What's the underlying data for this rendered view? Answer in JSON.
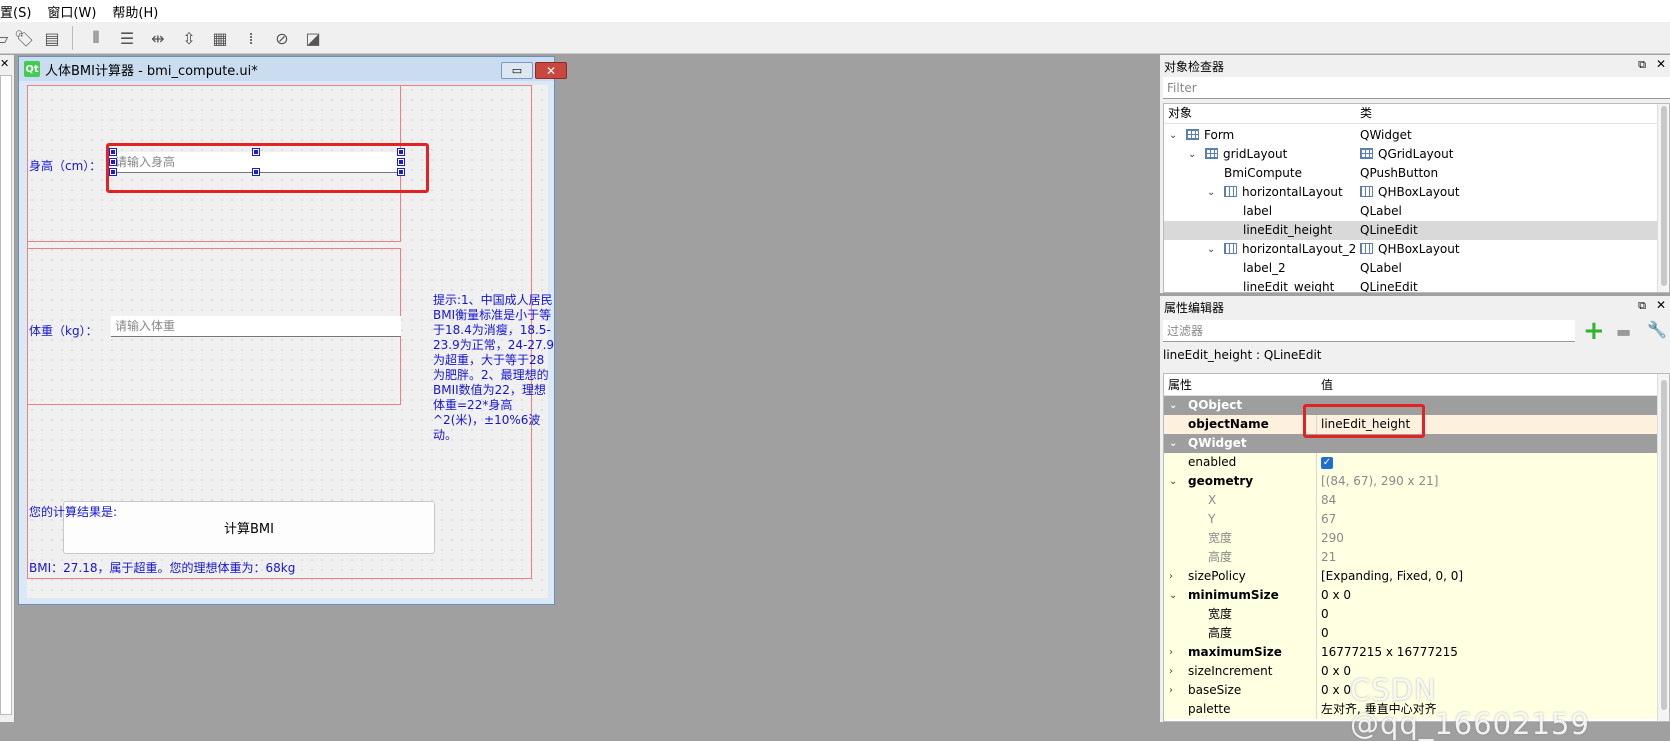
{
  "menubar": {
    "items": [
      "置(S)",
      "窗口(W)",
      "帮助(H)"
    ]
  },
  "form_window": {
    "title": "人体BMI计算器 - bmi_compute.ui*",
    "height_label": "身高（cm）：",
    "height_placeholder": "请输入身高",
    "weight_label": "体重（kg）：",
    "weight_placeholder": "请输入体重",
    "hint": "提示:1、中国成人居民BMI衡量标准是小于等于18.4为消瘦，18.5-23.9为正常，24-27.9为超重，大于等于28为肥胖。2、最理想的BMII数值为22，理想体重=22*身高^2(米)，±10%6波动。",
    "compute_button": "计算BMI",
    "result_label": "您的计算结果是:",
    "bmi_result": "BMI：27.18，属于超重。您的理想体重为：68kg"
  },
  "object_inspector": {
    "title": "对象检查器",
    "filter_placeholder": "Filter",
    "col_object": "对象",
    "col_class": "类",
    "rows": [
      {
        "name": "Form",
        "cls": "QWidget"
      },
      {
        "name": "gridLayout",
        "cls": "QGridLayout"
      },
      {
        "name": "BmiCompute",
        "cls": "QPushButton"
      },
      {
        "name": "horizontalLayout",
        "cls": "QHBoxLayout"
      },
      {
        "name": "label",
        "cls": "QLabel"
      },
      {
        "name": "lineEdit_height",
        "cls": "QLineEdit"
      },
      {
        "name": "horizontalLayout_2",
        "cls": "QHBoxLayout"
      },
      {
        "name": "label_2",
        "cls": "QLabel"
      },
      {
        "name": "lineEdit_weight",
        "cls": "QLineEdit"
      }
    ]
  },
  "property_editor": {
    "title": "属性编辑器",
    "filter_placeholder": "过滤器",
    "current": "lineEdit_height : QLineEdit",
    "col_property": "属性",
    "col_value": "值",
    "rows": [
      {
        "name": "QObject",
        "value": ""
      },
      {
        "name": "objectName",
        "value": "lineEdit_height"
      },
      {
        "name": "QWidget",
        "value": ""
      },
      {
        "name": "enabled",
        "value": ""
      },
      {
        "name": "geometry",
        "value": "[(84, 67), 290 x 21]"
      },
      {
        "name": "X",
        "value": "84"
      },
      {
        "name": "Y",
        "value": "67"
      },
      {
        "name": "宽度",
        "value": "290"
      },
      {
        "name": "高度",
        "value": "21"
      },
      {
        "name": "sizePolicy",
        "value": "[Expanding, Fixed, 0, 0]"
      },
      {
        "name": "minimumSize",
        "value": "0 x 0"
      },
      {
        "name": "宽度",
        "value": "0"
      },
      {
        "name": "高度",
        "value": "0"
      },
      {
        "name": "maximumSize",
        "value": "16777215 x 16777215"
      },
      {
        "name": "sizeIncrement",
        "value": "0 x 0"
      },
      {
        "name": "baseSize",
        "value": "0 x 0"
      },
      {
        "name": "palette",
        "value": "左对齐, 垂直中心对齐"
      }
    ]
  },
  "watermark": "CSDN @qq_16602159"
}
